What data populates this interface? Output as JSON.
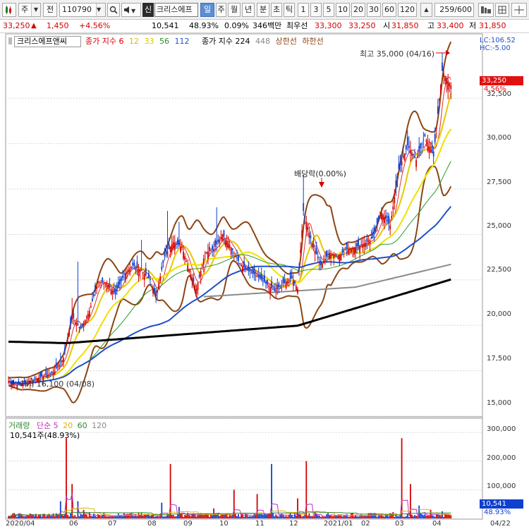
{
  "toolbar": {
    "type_select": "주",
    "market_select": "전",
    "code": "110790",
    "credit_badge": "신",
    "name": "크리스에프",
    "period_active": "일",
    "periods": [
      "주",
      "월",
      "년",
      "분",
      "초",
      "틱"
    ],
    "ticks": [
      "1",
      "3",
      "5",
      "10",
      "20",
      "30",
      "60",
      "120"
    ],
    "count": "259",
    "total": "/600"
  },
  "quote": {
    "price": "33,250",
    "change": "1,450",
    "change_pct": "+4.56%",
    "volume": "10,541",
    "vol_ratio": "48.93%",
    "turnover": "0.09%",
    "amount": "346백만",
    "best_ask_label": "최우선",
    "best_ask": "33,300",
    "best_bid": "33,250",
    "open_label": "시",
    "open": "31,850",
    "high_label": "고",
    "high": "33,400",
    "low_label": "저",
    "low": "31,850"
  },
  "price_pane": {
    "legend_title": "크리스에프앤씨",
    "ma_label": "종가 지수",
    "ma_periods": [
      "6",
      "12",
      "33",
      "56",
      "112"
    ],
    "ma_colors": [
      "#e03030",
      "#e6c800",
      "#f0e000",
      "#2a9a2a",
      "#2050c8"
    ],
    "long_ma_label": "종가 지수",
    "long_ma_periods": [
      "224",
      "448"
    ],
    "band_upper": "상한선",
    "band_lower": "하한선",
    "lc": "LC:106.52",
    "hc": "HC:-5.00",
    "current_tag": "33,250",
    "current_pct": "4.56%",
    "high_note": "최고 35,000 (04/16)",
    "low_note": "최저 16,100 (04/08)",
    "dividend_note": "배당락(0.00%)",
    "y_ticks": [
      "32,500",
      "30,000",
      "27,500",
      "25,000",
      "22,500",
      "20,000",
      "17,500",
      "15,000"
    ]
  },
  "volume_pane": {
    "legend_label": "거래량",
    "ma_label": "단순",
    "ma_periods": [
      "5",
      "20",
      "60",
      "120"
    ],
    "current_vol": "10,541주(48.93%)",
    "y_ticks": [
      "300,000",
      "200,000",
      "100,000"
    ],
    "last_tag": "10,541",
    "last_pct": "48.93%"
  },
  "x_axis": [
    "2020/04",
    "06",
    "07",
    "08",
    "09",
    "10",
    "11",
    "12",
    "2021/01",
    "02",
    "03",
    "04",
    "04/22"
  ],
  "colors": {
    "up": "#d40000",
    "down": "#0f3fd0",
    "envelope": "#8b4513",
    "ma224": "#000000",
    "ma448": "#8a8a8a"
  },
  "chart_data": {
    "type": "candlestick",
    "y_range": [
      15000,
      35500
    ],
    "anchors": [
      [
        0,
        16900
      ],
      [
        8,
        16700
      ],
      [
        16,
        17000
      ],
      [
        24,
        17200
      ],
      [
        31,
        17400
      ],
      [
        38,
        18200
      ],
      [
        44,
        20500
      ],
      [
        50,
        19800
      ],
      [
        56,
        20800
      ],
      [
        62,
        22400
      ],
      [
        68,
        22300
      ],
      [
        74,
        21700
      ],
      [
        80,
        22800
      ],
      [
        86,
        23300
      ],
      [
        92,
        23000
      ],
      [
        98,
        22500
      ],
      [
        102,
        21600
      ],
      [
        108,
        23800
      ],
      [
        114,
        24600
      ],
      [
        120,
        24300
      ],
      [
        126,
        22800
      ],
      [
        130,
        22000
      ],
      [
        136,
        24000
      ],
      [
        142,
        24200
      ],
      [
        148,
        25000
      ],
      [
        154,
        24300
      ],
      [
        160,
        23400
      ],
      [
        166,
        23000
      ],
      [
        172,
        22700
      ],
      [
        178,
        22300
      ],
      [
        184,
        21900
      ],
      [
        190,
        22300
      ],
      [
        196,
        22600
      ],
      [
        200,
        22000
      ],
      [
        204,
        26300
      ],
      [
        210,
        24500
      ],
      [
        216,
        23300
      ],
      [
        222,
        24000
      ],
      [
        228,
        23800
      ],
      [
        234,
        24200
      ],
      [
        240,
        24300
      ],
      [
        246,
        24500
      ],
      [
        252,
        24800
      ],
      [
        258,
        26200
      ],
      [
        264,
        25500
      ],
      [
        270,
        28600
      ],
      [
        276,
        29900
      ],
      [
        282,
        29100
      ],
      [
        288,
        30400
      ],
      [
        294,
        29300
      ],
      [
        300,
        34000
      ],
      [
        306,
        33200
      ]
    ],
    "spikes": [
      [
        36,
        18500
      ],
      [
        44,
        21500
      ],
      [
        48,
        23500
      ],
      [
        92,
        24700
      ],
      [
        110,
        26300
      ],
      [
        118,
        25700
      ],
      [
        144,
        26500
      ],
      [
        204,
        28300
      ],
      [
        276,
        30700
      ],
      [
        300,
        35000
      ]
    ],
    "volumes": [
      [
        0,
        8000
      ],
      [
        10,
        9000
      ],
      [
        20,
        7000
      ],
      [
        30,
        8500
      ],
      [
        36,
        60000
      ],
      [
        40,
        280000
      ],
      [
        44,
        120000
      ],
      [
        48,
        60000
      ],
      [
        52,
        30000
      ],
      [
        56,
        22000
      ],
      [
        62,
        15000
      ],
      [
        74,
        10000
      ],
      [
        86,
        11000
      ],
      [
        98,
        9000
      ],
      [
        106,
        55000
      ],
      [
        112,
        190000
      ],
      [
        118,
        40000
      ],
      [
        124,
        20000
      ],
      [
        136,
        14000
      ],
      [
        142,
        35000
      ],
      [
        148,
        13000
      ],
      [
        156,
        100000
      ],
      [
        164,
        18000
      ],
      [
        172,
        85000
      ],
      [
        182,
        190000
      ],
      [
        190,
        14000
      ],
      [
        200,
        70000
      ],
      [
        206,
        200000
      ],
      [
        212,
        25000
      ],
      [
        220,
        14000
      ],
      [
        232,
        12000
      ],
      [
        244,
        14000
      ],
      [
        256,
        12000
      ],
      [
        266,
        22000
      ],
      [
        272,
        280000
      ],
      [
        278,
        120000
      ],
      [
        284,
        45000
      ],
      [
        292,
        30000
      ],
      [
        300,
        25000
      ],
      [
        306,
        11000
      ]
    ]
  }
}
